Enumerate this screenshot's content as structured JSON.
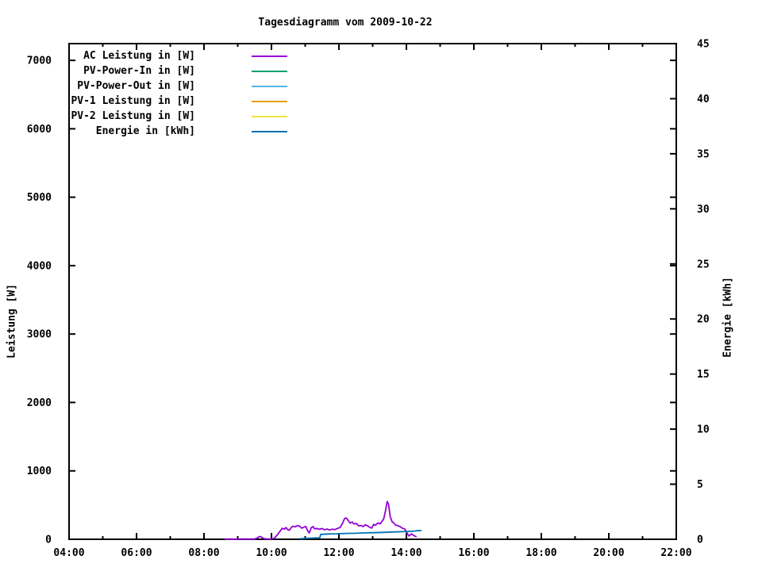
{
  "title": "Tagesdiagramm vom 2009-10-22",
  "axes": {
    "left": {
      "label": "Leistung [W]",
      "tick_labels": [
        "0",
        "1000",
        "2000",
        "3000",
        "4000",
        "5000",
        "6000",
        "7000"
      ],
      "tick_values": [
        0,
        1000,
        2000,
        3000,
        4000,
        5000,
        6000,
        7000
      ],
      "range": [
        0,
        7245
      ]
    },
    "right": {
      "label": "Energie [kWh]",
      "tick_labels": [
        "0",
        "5",
        "10",
        "15",
        "20",
        "25",
        "30",
        "35",
        "40",
        "45"
      ],
      "tick_values": [
        0,
        5,
        10,
        15,
        20,
        25,
        30,
        35,
        40,
        45
      ],
      "range": [
        0,
        45
      ]
    },
    "x": {
      "tick_labels": [
        "04:00",
        "06:00",
        "08:00",
        "10:00",
        "12:00",
        "14:00",
        "16:00",
        "18:00",
        "20:00",
        "22:00"
      ],
      "tick_hours": [
        4,
        6,
        8,
        10,
        12,
        14,
        16,
        18,
        20,
        22
      ],
      "minor_hours": [
        5,
        7,
        9,
        11,
        13,
        15,
        17,
        19,
        21
      ],
      "range": [
        4,
        22
      ]
    }
  },
  "legend": [
    {
      "label": "AC Leistung in [W]",
      "color": "#9400d3"
    },
    {
      "label": "PV-Power-In in [W]",
      "color": "#009e73"
    },
    {
      "label": "PV-Power-Out in [W]",
      "color": "#56b4e9"
    },
    {
      "label": "PV-1 Leistung in [W]",
      "color": "#e69f00"
    },
    {
      "label": "PV-2 Leistung in [W]",
      "color": "#f0e442"
    },
    {
      "label": "Energie in [kWh]",
      "color": "#0072b2"
    }
  ],
  "chart_data": {
    "type": "line",
    "title": "Tagesdiagramm vom 2009-10-22",
    "xlabel": "",
    "ylabel": "Leistung [W]",
    "y2label": "Energie [kWh]",
    "x_unit": "hours",
    "xlim": [
      4,
      22
    ],
    "ylim": [
      0,
      7245
    ],
    "y2lim": [
      0,
      45
    ],
    "grid": false,
    "legend_position": "top-left-inside",
    "series": [
      {
        "name": "AC Leistung in [W]",
        "color": "#9400d3",
        "axis": "y1",
        "points": [
          [
            8.62,
            2
          ],
          [
            8.75,
            3
          ],
          [
            8.9,
            2
          ],
          [
            9.05,
            4
          ],
          [
            9.2,
            3
          ],
          [
            9.35,
            3
          ],
          [
            9.5,
            5
          ],
          [
            9.58,
            18
          ],
          [
            9.63,
            36
          ],
          [
            9.68,
            40
          ],
          [
            9.73,
            22
          ],
          [
            9.79,
            8
          ],
          [
            9.9,
            5
          ],
          [
            10.0,
            6
          ],
          [
            10.08,
            15
          ],
          [
            10.17,
            60
          ],
          [
            10.25,
            115
          ],
          [
            10.32,
            160
          ],
          [
            10.38,
            148
          ],
          [
            10.43,
            172
          ],
          [
            10.48,
            140
          ],
          [
            10.53,
            132
          ],
          [
            10.58,
            168
          ],
          [
            10.63,
            190
          ],
          [
            10.7,
            182
          ],
          [
            10.77,
            200
          ],
          [
            10.83,
            192
          ],
          [
            10.9,
            162
          ],
          [
            10.97,
            178
          ],
          [
            11.02,
            188
          ],
          [
            11.07,
            128
          ],
          [
            11.12,
            92
          ],
          [
            11.18,
            168
          ],
          [
            11.23,
            185
          ],
          [
            11.28,
            152
          ],
          [
            11.35,
            158
          ],
          [
            11.42,
            146
          ],
          [
            11.5,
            158
          ],
          [
            11.57,
            139
          ],
          [
            11.65,
            150
          ],
          [
            11.72,
            136
          ],
          [
            11.8,
            148
          ],
          [
            11.88,
            142
          ],
          [
            11.95,
            158
          ],
          [
            12.03,
            172
          ],
          [
            12.1,
            225
          ],
          [
            12.17,
            305
          ],
          [
            12.22,
            312
          ],
          [
            12.28,
            270
          ],
          [
            12.33,
            238
          ],
          [
            12.4,
            252
          ],
          [
            12.45,
            222
          ],
          [
            12.52,
            232
          ],
          [
            12.58,
            196
          ],
          [
            12.65,
            202
          ],
          [
            12.72,
            186
          ],
          [
            12.78,
            212
          ],
          [
            12.85,
            196
          ],
          [
            12.9,
            178
          ],
          [
            12.97,
            162
          ],
          [
            13.03,
            218
          ],
          [
            13.08,
            204
          ],
          [
            13.15,
            238
          ],
          [
            13.22,
            226
          ],
          [
            13.28,
            262
          ],
          [
            13.33,
            300
          ],
          [
            13.38,
            420
          ],
          [
            13.43,
            552
          ],
          [
            13.47,
            512
          ],
          [
            13.52,
            330
          ],
          [
            13.58,
            252
          ],
          [
            13.63,
            238
          ],
          [
            13.68,
            205
          ],
          [
            13.75,
            198
          ],
          [
            13.82,
            182
          ],
          [
            13.88,
            162
          ],
          [
            13.95,
            150
          ],
          [
            14.02,
            92
          ],
          [
            14.08,
            48
          ],
          [
            14.15,
            80
          ],
          [
            14.22,
            55
          ],
          [
            14.3,
            36
          ]
        ]
      },
      {
        "name": "PV-Power-In in [W]",
        "color": "#009e73",
        "axis": "y1",
        "points": []
      },
      {
        "name": "PV-Power-Out in [W]",
        "color": "#56b4e9",
        "axis": "y1",
        "points": []
      },
      {
        "name": "PV-1 Leistung in [W]",
        "color": "#e69f00",
        "axis": "y1",
        "points": []
      },
      {
        "name": "PV-2 Leistung in [W]",
        "color": "#f0e442",
        "axis": "y1",
        "points": []
      },
      {
        "name": "Energie in [kWh]",
        "color": "#0072b2",
        "axis": "y2",
        "points": [
          [
            10.85,
            0.05
          ],
          [
            11.0,
            0.08
          ],
          [
            11.15,
            0.1
          ],
          [
            11.3,
            0.12
          ],
          [
            11.43,
            0.13
          ],
          [
            11.46,
            0.45
          ],
          [
            11.7,
            0.48
          ],
          [
            11.95,
            0.5
          ],
          [
            12.2,
            0.53
          ],
          [
            12.5,
            0.55
          ],
          [
            12.8,
            0.58
          ],
          [
            13.0,
            0.6
          ],
          [
            13.3,
            0.63
          ],
          [
            13.6,
            0.66
          ],
          [
            13.9,
            0.69
          ],
          [
            14.1,
            0.72
          ],
          [
            14.25,
            0.75
          ],
          [
            14.3,
            0.78
          ],
          [
            14.45,
            0.79
          ]
        ]
      }
    ]
  },
  "style": {
    "axis_color": "#000000",
    "background": "#ffffff"
  }
}
